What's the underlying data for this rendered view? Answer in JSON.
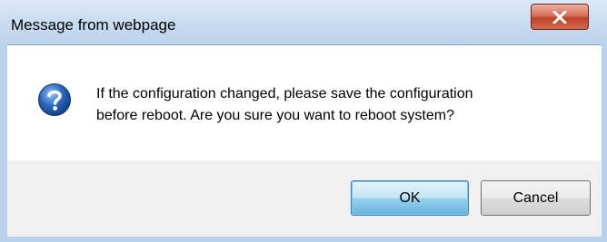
{
  "dialog": {
    "title": "Message from webpage",
    "message_line1": "If the configuration changed, please save the configuration",
    "message_line2": "before reboot. Are you sure you want to reboot system?",
    "icon": "question-icon"
  },
  "buttons": {
    "ok_label": "OK",
    "cancel_label": "Cancel",
    "close_icon": "close-icon"
  },
  "colors": {
    "frame": "#b9d1ea",
    "close_button": "#c0432a",
    "default_button": "#3c7fb1",
    "icon_blue": "#2a62b8"
  }
}
